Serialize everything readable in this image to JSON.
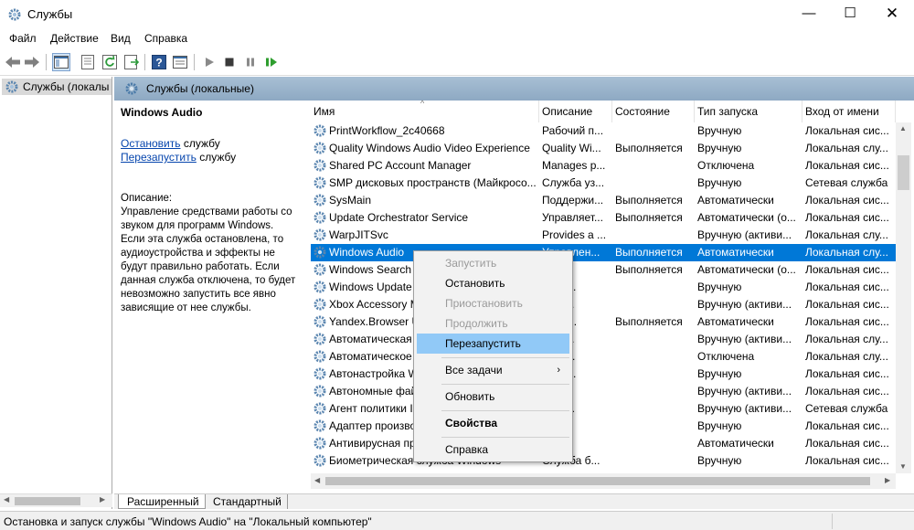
{
  "window": {
    "title": "Службы"
  },
  "menu": [
    "Файл",
    "Действие",
    "Вид",
    "Справка"
  ],
  "tree": {
    "item": "Службы (локалы"
  },
  "panel": {
    "header": "Службы (локальные)"
  },
  "details": {
    "service_name": "Windows Audio",
    "stop_link": "Остановить",
    "stop_suffix": " службу",
    "restart_link": "Перезапустить",
    "restart_suffix": " службу",
    "description_label": "Описание:",
    "description_lines": [
      "Управление средствами работы со",
      "звуком для программ Windows.",
      "Если эта служба остановлена, то",
      "аудиоустройства и эффекты не",
      "будут правильно работать.  Если",
      "данная служба отключена, то будет",
      "невозможно запустить все явно",
      "зависящие от нее службы."
    ]
  },
  "columns": [
    "Имя",
    "Описание",
    "Состояние",
    "Тип запуска",
    "Вход от имени"
  ],
  "rows": [
    [
      "PrintWorkflow_2c40668",
      "Рабочий п...",
      "",
      "Вручную",
      "Локальная сис..."
    ],
    [
      "Quality Windows Audio Video Experience",
      "Quality Wi...",
      "Выполняется",
      "Вручную",
      "Локальная слу..."
    ],
    [
      "Shared PC Account Manager",
      "Manages p...",
      "",
      "Отключена",
      "Локальная сис..."
    ],
    [
      "SMP дисковых пространств (Майкросо...",
      "Служба уз...",
      "",
      "Вручную",
      "Сетевая служба"
    ],
    [
      "SysMain",
      "Поддержи...",
      "Выполняется",
      "Автоматически",
      "Локальная сис..."
    ],
    [
      "Update Orchestrator Service",
      "Управляет...",
      "Выполняется",
      "Автоматически (о...",
      "Локальная сис..."
    ],
    [
      "WarpJITSvc",
      "Provides a ...",
      "",
      "Вручную (активи...",
      "Локальная слу..."
    ],
    [
      "Windows Audio",
      "Управлен...",
      "Выполняется",
      "Автоматически",
      "Локальная слу..."
    ],
    [
      "Windows Search",
      "ксир...",
      "Выполняется",
      "Автоматически (о...",
      "Локальная сис..."
    ],
    [
      "Windows Update",
      "ключ...",
      "",
      "Вручную",
      "Локальная сис..."
    ],
    [
      "Xbox Accessory M",
      "ervic...",
      "",
      "Вручную (активи...",
      "Локальная сис..."
    ],
    [
      "Yandex.Browser U",
      "ержи...",
      "Выполняется",
      "Автоматически",
      "Локальная сис..."
    ],
    [
      "Автоматическая",
      "омат...",
      "",
      "Вручную (активи...",
      "Локальная слу..."
    ],
    [
      "Автоматическое",
      "авля...",
      "",
      "Отключена",
      "Локальная слу..."
    ],
    [
      "Автонастройка W",
      "ба W...",
      "",
      "Вручную",
      "Локальная сис..."
    ],
    [
      "Автономные фай",
      "ба ...",
      "",
      "Вручную (активи...",
      "Локальная сис..."
    ],
    [
      "Агент политики I",
      "асно...",
      "",
      "Вручную (активи...",
      "Сетевая служба"
    ],
    [
      "Адаптер произво",
      "став...",
      "",
      "Вручную",
      "Локальная сис..."
    ],
    [
      "Антивирусная пр",
      "огае...",
      "",
      "Автоматически",
      "Локальная сис..."
    ],
    [
      "Биометрическая служба Windows",
      "Служба б...",
      "",
      "Вручную",
      "Локальная сис..."
    ]
  ],
  "context_menu": [
    "Запустить",
    "Остановить",
    "Приостановить",
    "Продолжить",
    "Перезапустить",
    "Все задачи",
    "Обновить",
    "Свойства",
    "Справка"
  ],
  "tabs": [
    "Расширенный",
    "Стандартный"
  ],
  "status": "Остановка и запуск службы \"Windows Audio\" на \"Локальный компьютер\"",
  "icons": {
    "service": "gear-icon",
    "back": "arrow-left-icon",
    "forward": "arrow-right-icon",
    "play": "play-icon",
    "stop": "stop-icon",
    "pause": "pause-icon",
    "restart": "restart-icon"
  },
  "colors": {
    "selection": "#0078d7",
    "menu_hover": "#91c9f7",
    "panel_header": "#98b2cb",
    "link": "#0645ad",
    "play_green": "#2f9e2f"
  }
}
